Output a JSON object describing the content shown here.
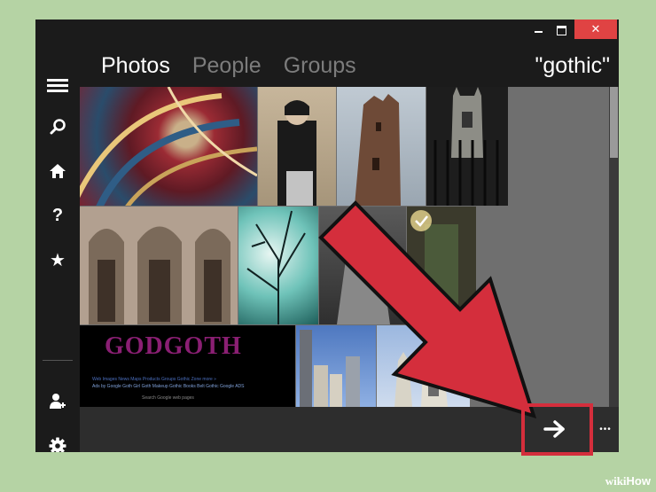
{
  "window": {
    "minimize_icon": "minimize-icon",
    "maximize_icon": "maximize-icon",
    "close_label": "✕"
  },
  "header": {
    "tabs": [
      {
        "label": "Photos",
        "active": true
      },
      {
        "label": "People",
        "active": false
      },
      {
        "label": "Groups",
        "active": false
      }
    ],
    "query": "\"gothic\""
  },
  "sidebar": {
    "items": [
      {
        "icon": "menu-icon"
      },
      {
        "icon": "search-icon"
      },
      {
        "icon": "home-icon"
      },
      {
        "icon": "help-icon",
        "glyph": "?"
      },
      {
        "icon": "star-icon",
        "glyph": "★"
      },
      {
        "icon": "add-user-icon"
      },
      {
        "icon": "settings-icon"
      }
    ]
  },
  "photos": {
    "godgoth_title": "GODGOTH",
    "godgoth_links": "Web  Images  News  Maps  Products  Groups  Gothic Zone  more »",
    "godgoth_sub": "Ads by Google   Goth Girl   Goth Makeup   Gothic Books   Belt Gothic   Google ADS",
    "godgoth_search": "Search Google web pages"
  },
  "appbar": {
    "next_icon": "arrow-right-icon",
    "more_label": "•••"
  },
  "watermark": {
    "wiki": "wiki",
    "how": "How"
  },
  "colors": {
    "background": "#b5d3a4",
    "window": "#1b1b1b",
    "accent_red": "#d42e3c",
    "close_red": "#e04343"
  }
}
